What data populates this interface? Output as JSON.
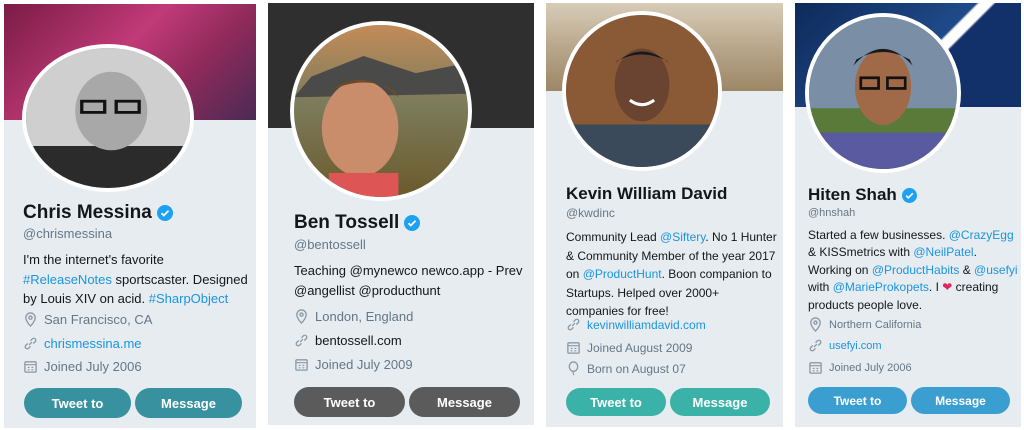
{
  "cards": [
    {
      "name": "Chris Messina",
      "handle": "@chrismessina",
      "bio_plain1": "I'm the internet's favorite ",
      "bio_link1": "#ReleaseNotes",
      "bio_plain2": " sportscaster. Designed by Louis XIV on acid. ",
      "bio_link2": "#SharpObject",
      "location": "San Francisco, CA",
      "website": "chrismessina.me",
      "joined": "Joined July 2006",
      "tweet_label": "Tweet to",
      "message_label": "Message",
      "button_color": "#37919e",
      "banner_color": "#a0305f"
    },
    {
      "name": "Ben Tossell",
      "handle": "@bentossell",
      "bio": "Teaching @mynewco newco.app - Prev @angellist @producthunt",
      "location": "London, England",
      "website": "bentossell.com",
      "joined": "Joined July 2009",
      "tweet_label": "Tweet to",
      "message_label": "Message",
      "button_color": "#5b5b5b",
      "banner_color": "#2f2f2f"
    },
    {
      "name": "Kevin William David",
      "handle": "@kwdinc",
      "bio_plain1": "Community Lead ",
      "bio_link1": "@Siftery",
      "bio_plain2": ". No 1 Hunter & Community Member of the year 2017 on ",
      "bio_link2": "@ProductHunt",
      "bio_plain3": ". Boon companion to Startups. Helped over 2000+ companies for free!",
      "website": "kevinwilliamdavid.com",
      "joined": "Joined August 2009",
      "born": "Born on August 07",
      "tweet_label": "Tweet to",
      "message_label": "Message",
      "button_color": "#3bb2a8",
      "banner_color": "#c9b9a2"
    },
    {
      "name": "Hiten Shah",
      "handle": "@hnshah",
      "bio_plain1": "Started a few businesses. ",
      "bio_link1": "@CrazyEgg",
      "bio_plain2": " & KISSmetrics with ",
      "bio_link2": "@NeilPatel",
      "bio_plain3": ". Working on ",
      "bio_link3": "@ProductHabits",
      "bio_plain4": " & ",
      "bio_link4": "@usefyi",
      "bio_plain5": " with ",
      "bio_link5": "@MarieProkopets",
      "bio_plain6": ". I ",
      "bio_heart": "❤",
      "bio_plain7": " creating products people love.",
      "location": "Northern California",
      "website": "usefyi.com",
      "joined": "Joined July 2006",
      "tweet_label": "Tweet to",
      "message_label": "Message",
      "button_color": "#3a9fd0",
      "banner_color": "#1f3f7a"
    }
  ],
  "icons": {
    "verified": "verified-badge-icon",
    "location": "location-pin-icon",
    "link": "link-icon",
    "calendar": "calendar-icon",
    "balloon": "birthday-balloon-icon"
  }
}
